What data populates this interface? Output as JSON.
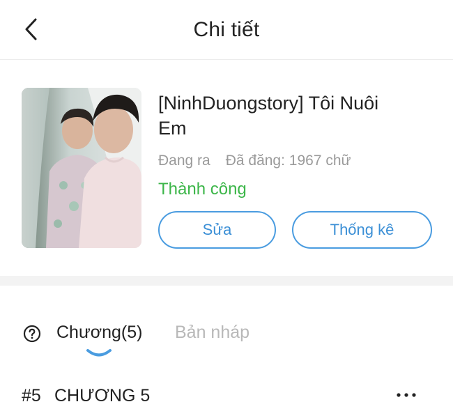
{
  "header": {
    "back_icon": "chevron-left-icon",
    "title": "Chi tiết"
  },
  "book": {
    "cover_icon": "book-cover-photo",
    "title": "[NinhDuongstory] Tôi Nuôi Em",
    "publish_status": "Đang ra",
    "word_count": "Đã đăng: 1967 chữ",
    "result_status": "Thành công",
    "result_color": "#3cb649",
    "edit_label": "Sửa",
    "stats_label": "Thống kê",
    "accent_color": "#4a9ce0"
  },
  "tabs": {
    "help_icon": "question-circle-icon",
    "items": [
      {
        "label": "Chương(5)",
        "active": true
      },
      {
        "label": "Bản nháp",
        "active": false
      }
    ]
  },
  "chapters": [
    {
      "number": "#5",
      "title": "CHƯƠNG 5",
      "more_icon": "more-horizontal-icon"
    }
  ]
}
